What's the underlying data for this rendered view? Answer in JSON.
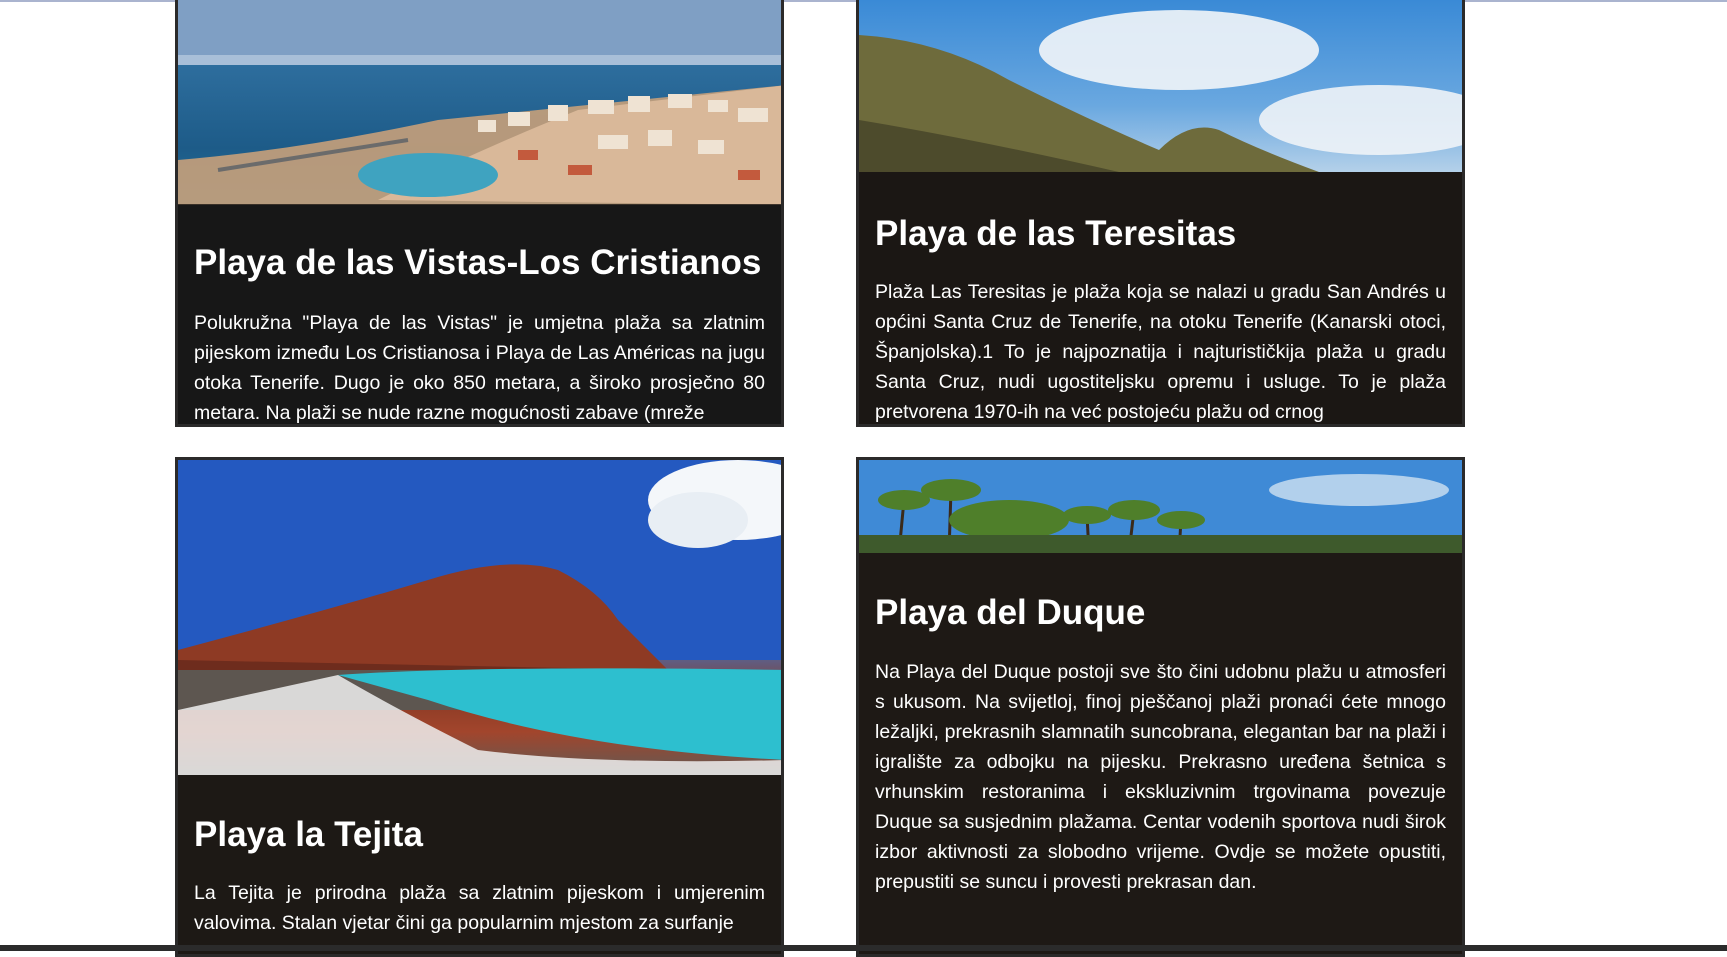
{
  "cards": [
    {
      "title": "Playa de las Vistas-Los Cristianos",
      "text": "Polukružna \"Playa de las Vistas\" je umjetna plaža sa zlatnim pijeskom između Los Cristianosa i Playa de Las Américas na jugu otoka Tenerife. Dugo je oko 850 metara, a široko prosječno 80 metara. Na plaži se nude razne mogućnosti zabave (mreže"
    },
    {
      "title": "Playa de las Teresitas",
      "text": "Plaža Las Teresitas je plaža koja se nalazi u gradu San Andrés u općini Santa Cruz de Tenerife, na otoku Tenerife (Kanarski otoci, Španjolska).1 To je najpoznatija i najturističkija plaža u gradu Santa Cruz, nudi ugostiteljsku opremu i usluge. To je plaža pretvorena 1970-ih na već postojeću plažu od crnog"
    },
    {
      "title": "Playa la Tejita",
      "text": "La Tejita je prirodna plaža sa zlatnim pijeskom i umjerenim valovima. Stalan vjetar čini ga popularnim mjestom za surfanje"
    },
    {
      "title": "Playa del Duque",
      "text": "Na Playa del Duque postoji sve što čini udobnu plažu u atmosferi s ukusom. Na svijetloj, finoj pješčanoj plaži pronaći ćete mnogo ležaljki, prekrasnih slamnatih suncobrana, elegantan bar na plaži i igralište za odbojku na pijesku. Prekrasno uređena šetnica s vrhunskim restoranima i ekskluzivnim trgovinama povezuje Duque sa susjednim plažama. Centar vodenih sportova nudi širok izbor aktivnosti za slobodno vrijeme. Ovdje se možete opustiti, prepustiti se suncu i provesti prekrasan dan."
    }
  ]
}
